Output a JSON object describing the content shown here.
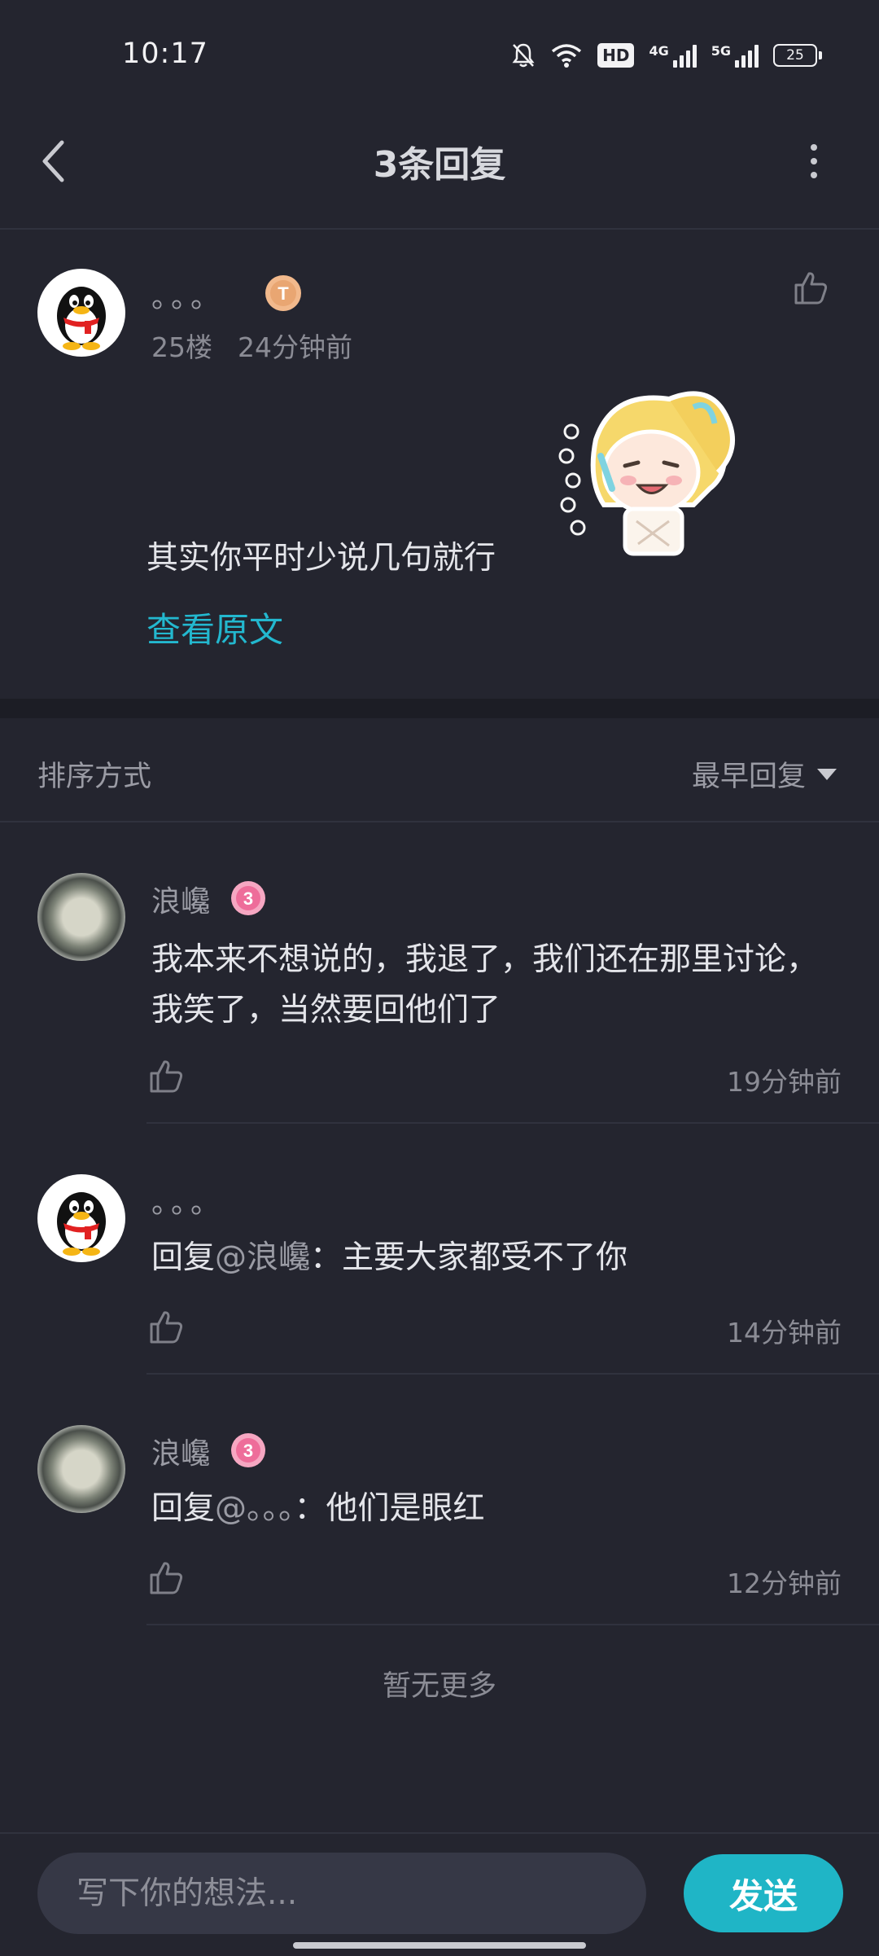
{
  "status_bar": {
    "time": "10:17",
    "hd_label": "HD",
    "signal_1_label": "4G",
    "signal_2_label": "5G",
    "battery_level": "25"
  },
  "header": {
    "title": "3条回复"
  },
  "main_post": {
    "user_name": "。。。",
    "floor": "25楼",
    "time": "24分钟前",
    "content": "其实你平时少说几句就行",
    "view_original": "查看原文"
  },
  "sort": {
    "label": "排序方式",
    "value": "最早回复"
  },
  "replies": [
    {
      "user_name": "浪巉",
      "content_prefix": "",
      "mention": "",
      "content": "我本来不想说的，我退了，我们还在那里讨论，我笑了，当然要回他们了",
      "time": "19分钟前"
    },
    {
      "user_name": "。。。",
      "content_prefix": "回复",
      "mention": "@浪巉",
      "content": "：主要大家都受不了你",
      "time": "14分钟前"
    },
    {
      "user_name": "浪巉",
      "content_prefix": "回复",
      "mention": "@。。。",
      "content": "：他们是眼红",
      "time": "12分钟前"
    }
  ],
  "footer_note": "暂无更多",
  "composer": {
    "placeholder": "写下你的想法...",
    "send_label": "发送"
  },
  "colors": {
    "background": "#24252f",
    "accent": "#1fb5c6",
    "link": "#23b8cf"
  }
}
